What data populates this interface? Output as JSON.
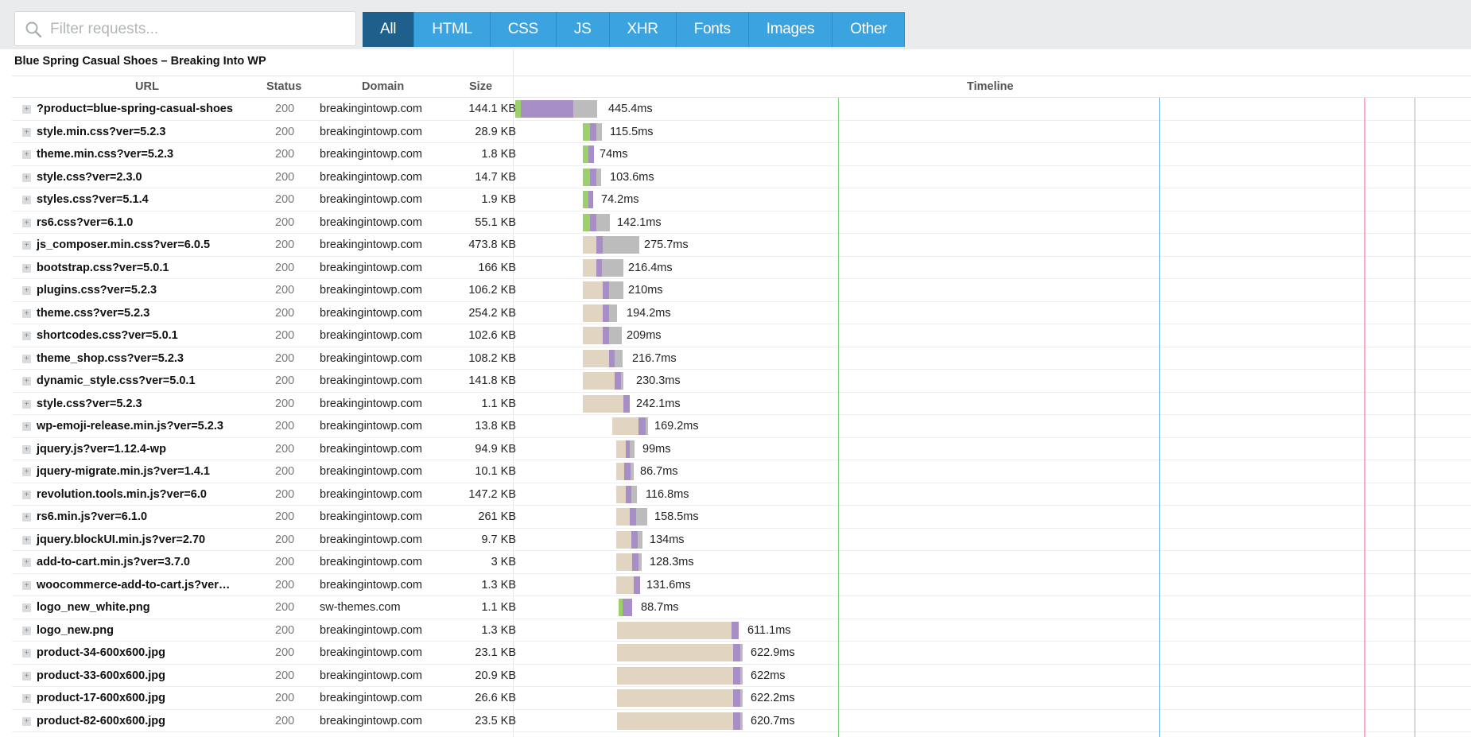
{
  "search": {
    "placeholder": "Filter requests..."
  },
  "filters": [
    "All",
    "HTML",
    "CSS",
    "JS",
    "XHR",
    "Fonts",
    "Images",
    "Other"
  ],
  "active_filter": "All",
  "page_title": "Blue Spring Casual Shoes – Breaking Into WP",
  "columns": {
    "url": "URL",
    "status": "Status",
    "domain": "Domain",
    "size": "Size",
    "timeline": "Timeline"
  },
  "colors": {
    "waiting": "#e1d5c1",
    "dns": "#9bd06a",
    "connect": "#a78ec7",
    "receive": "#bcbcbc",
    "markers": [
      "#7bd17e",
      "#6cb0e8",
      "#e57f99",
      "#9ab2c4"
    ]
  },
  "requests": [
    {
      "url": "?product=blue-spring-casual-shoes",
      "status": "200",
      "domain": "breakingintowp.com",
      "size": "144.1 KB",
      "duration": "445.4ms"
    },
    {
      "url": "style.min.css?ver=5.2.3",
      "status": "200",
      "domain": "breakingintowp.com",
      "size": "28.9 KB",
      "duration": "115.5ms"
    },
    {
      "url": "theme.min.css?ver=5.2.3",
      "status": "200",
      "domain": "breakingintowp.com",
      "size": "1.8 KB",
      "duration": "74ms"
    },
    {
      "url": "style.css?ver=2.3.0",
      "status": "200",
      "domain": "breakingintowp.com",
      "size": "14.7 KB",
      "duration": "103.6ms"
    },
    {
      "url": "styles.css?ver=5.1.4",
      "status": "200",
      "domain": "breakingintowp.com",
      "size": "1.9 KB",
      "duration": "74.2ms"
    },
    {
      "url": "rs6.css?ver=6.1.0",
      "status": "200",
      "domain": "breakingintowp.com",
      "size": "55.1 KB",
      "duration": "142.1ms"
    },
    {
      "url": "js_composer.min.css?ver=6.0.5",
      "status": "200",
      "domain": "breakingintowp.com",
      "size": "473.8 KB",
      "duration": "275.7ms"
    },
    {
      "url": "bootstrap.css?ver=5.0.1",
      "status": "200",
      "domain": "breakingintowp.com",
      "size": "166 KB",
      "duration": "216.4ms"
    },
    {
      "url": "plugins.css?ver=5.2.3",
      "status": "200",
      "domain": "breakingintowp.com",
      "size": "106.2 KB",
      "duration": "210ms"
    },
    {
      "url": "theme.css?ver=5.2.3",
      "status": "200",
      "domain": "breakingintowp.com",
      "size": "254.2 KB",
      "duration": "194.2ms"
    },
    {
      "url": "shortcodes.css?ver=5.0.1",
      "status": "200",
      "domain": "breakingintowp.com",
      "size": "102.6 KB",
      "duration": "209ms"
    },
    {
      "url": "theme_shop.css?ver=5.2.3",
      "status": "200",
      "domain": "breakingintowp.com",
      "size": "108.2 KB",
      "duration": "216.7ms"
    },
    {
      "url": "dynamic_style.css?ver=5.0.1",
      "status": "200",
      "domain": "breakingintowp.com",
      "size": "141.8 KB",
      "duration": "230.3ms"
    },
    {
      "url": "style.css?ver=5.2.3",
      "status": "200",
      "domain": "breakingintowp.com",
      "size": "1.1 KB",
      "duration": "242.1ms"
    },
    {
      "url": "wp-emoji-release.min.js?ver=5.2.3",
      "status": "200",
      "domain": "breakingintowp.com",
      "size": "13.8 KB",
      "duration": "169.2ms"
    },
    {
      "url": "jquery.js?ver=1.12.4-wp",
      "status": "200",
      "domain": "breakingintowp.com",
      "size": "94.9 KB",
      "duration": "99ms"
    },
    {
      "url": "jquery-migrate.min.js?ver=1.4.1",
      "status": "200",
      "domain": "breakingintowp.com",
      "size": "10.1 KB",
      "duration": "86.7ms"
    },
    {
      "url": "revolution.tools.min.js?ver=6.0",
      "status": "200",
      "domain": "breakingintowp.com",
      "size": "147.2 KB",
      "duration": "116.8ms"
    },
    {
      "url": "rs6.min.js?ver=6.1.0",
      "status": "200",
      "domain": "breakingintowp.com",
      "size": "261 KB",
      "duration": "158.5ms"
    },
    {
      "url": "jquery.blockUI.min.js?ver=2.70",
      "status": "200",
      "domain": "breakingintowp.com",
      "size": "9.7 KB",
      "duration": "134ms"
    },
    {
      "url": "add-to-cart.min.js?ver=3.7.0",
      "status": "200",
      "domain": "breakingintowp.com",
      "size": "3 KB",
      "duration": "128.3ms"
    },
    {
      "url": "woocommerce-add-to-cart.js?ver…",
      "status": "200",
      "domain": "breakingintowp.com",
      "size": "1.3 KB",
      "duration": "131.6ms"
    },
    {
      "url": "logo_new_white.png",
      "status": "200",
      "domain": "sw-themes.com",
      "size": "1.1 KB",
      "duration": "88.7ms"
    },
    {
      "url": "logo_new.png",
      "status": "200",
      "domain": "breakingintowp.com",
      "size": "1.3 KB",
      "duration": "611.1ms"
    },
    {
      "url": "product-34-600x600.jpg",
      "status": "200",
      "domain": "breakingintowp.com",
      "size": "23.1 KB",
      "duration": "622.9ms"
    },
    {
      "url": "product-33-600x600.jpg",
      "status": "200",
      "domain": "breakingintowp.com",
      "size": "20.9 KB",
      "duration": "622ms"
    },
    {
      "url": "product-17-600x600.jpg",
      "status": "200",
      "domain": "breakingintowp.com",
      "size": "26.6 KB",
      "duration": "622.2ms"
    },
    {
      "url": "product-82-600x600.jpg",
      "status": "200",
      "domain": "breakingintowp.com",
      "size": "23.5 KB",
      "duration": "620.7ms"
    }
  ]
}
